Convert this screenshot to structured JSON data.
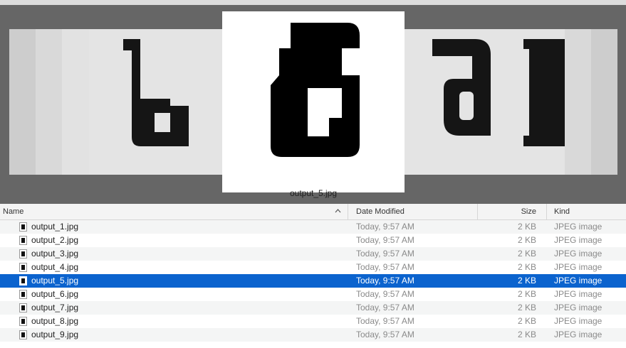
{
  "coverflow": {
    "selected_caption": "output_5.jpg",
    "background": "#666666"
  },
  "list": {
    "columns": {
      "name": "Name",
      "date": "Date Modified",
      "size": "Size",
      "kind": "Kind"
    },
    "sort_indicator": "^",
    "rows": [
      {
        "name": "output_1.jpg",
        "date": "Today, 9:57 AM",
        "size": "2 KB",
        "kind": "JPEG image",
        "selected": false
      },
      {
        "name": "output_2.jpg",
        "date": "Today, 9:57 AM",
        "size": "2 KB",
        "kind": "JPEG image",
        "selected": false
      },
      {
        "name": "output_3.jpg",
        "date": "Today, 9:57 AM",
        "size": "2 KB",
        "kind": "JPEG image",
        "selected": false
      },
      {
        "name": "output_4.jpg",
        "date": "Today, 9:57 AM",
        "size": "2 KB",
        "kind": "JPEG image",
        "selected": false
      },
      {
        "name": "output_5.jpg",
        "date": "Today, 9:57 AM",
        "size": "2 KB",
        "kind": "JPEG image",
        "selected": true
      },
      {
        "name": "output_6.jpg",
        "date": "Today, 9:57 AM",
        "size": "2 KB",
        "kind": "JPEG image",
        "selected": false
      },
      {
        "name": "output_7.jpg",
        "date": "Today, 9:57 AM",
        "size": "2 KB",
        "kind": "JPEG image",
        "selected": false
      },
      {
        "name": "output_8.jpg",
        "date": "Today, 9:57 AM",
        "size": "2 KB",
        "kind": "JPEG image",
        "selected": false
      },
      {
        "name": "output_9.jpg",
        "date": "Today, 9:57 AM",
        "size": "2 KB",
        "kind": "JPEG image",
        "selected": false
      }
    ],
    "selection_color": "#0b63ce"
  }
}
